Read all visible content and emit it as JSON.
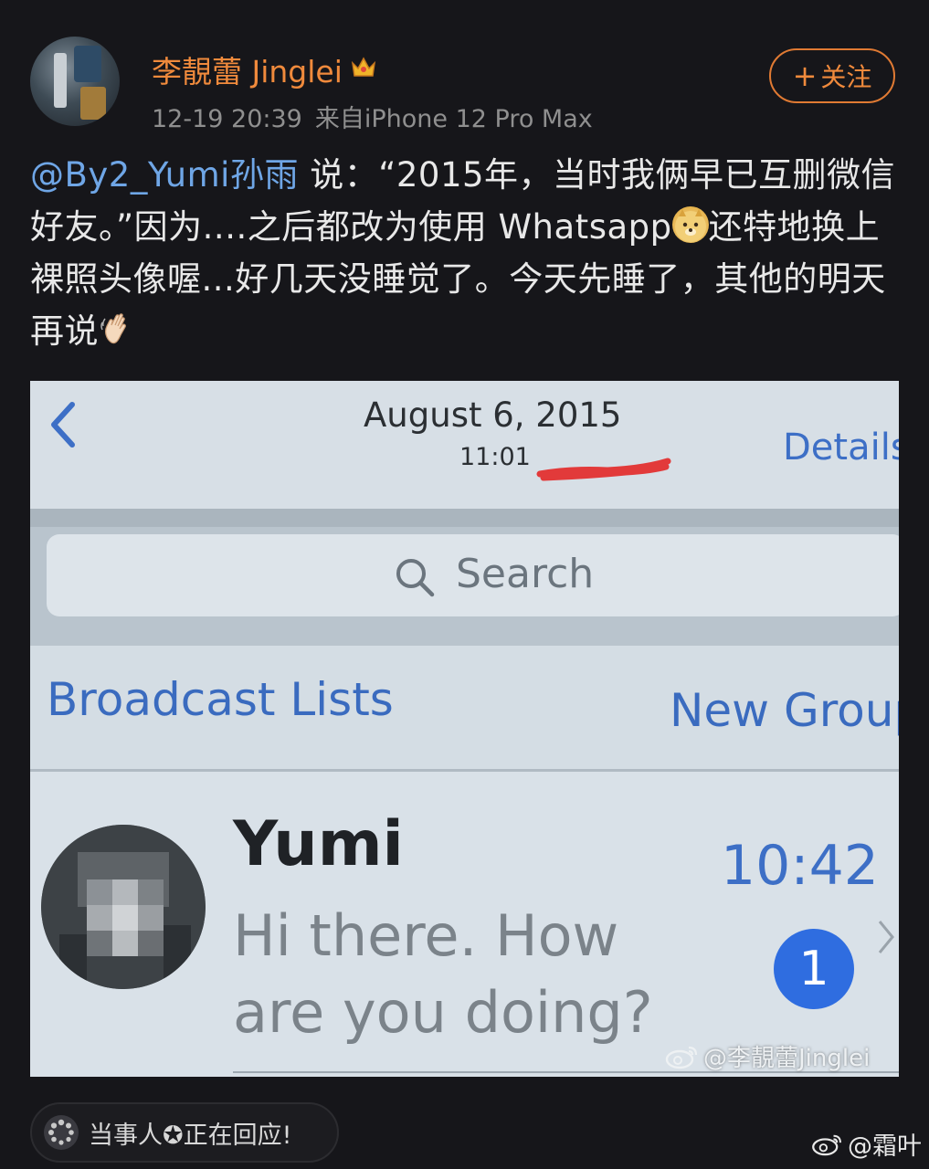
{
  "post": {
    "author": "李靚蕾 Jinglei",
    "verified_icon": "crown-badge-icon",
    "date": "12-19 20:39",
    "source": "来自iPhone 12 Pro Max",
    "follow_label": "关注",
    "text": {
      "mention": "@By2_Yumi孙雨",
      "part1": " 说：“2015年，当时我俩早已互删微信好友。”因为....之后都改为使用 Whatsapp",
      "part2": "还特地换上裸照头像喔...好几天没睡觉了。今天先睡了，其他的明天再说"
    }
  },
  "screenshot": {
    "date": "August 6, 2015",
    "time": "11:01",
    "details": "Details",
    "search_placeholder": "Search",
    "broadcast_lists": "Broadcast Lists",
    "new_group": "New Group",
    "chat": {
      "name": "Yumi",
      "time": "10:42",
      "message": "Hi there. How are you doing?",
      "unread": "1"
    },
    "watermark": "@李靚蕾Jinglei"
  },
  "footer": {
    "status_text": "当事人✪正在回应!",
    "credit": "@霜叶"
  },
  "colors": {
    "accent_orange": "#f08a3c",
    "mention_blue": "#6fa6e6",
    "ios_blue": "#3a6bbf",
    "badge_blue": "#2f6de0",
    "background": "#16161a"
  }
}
